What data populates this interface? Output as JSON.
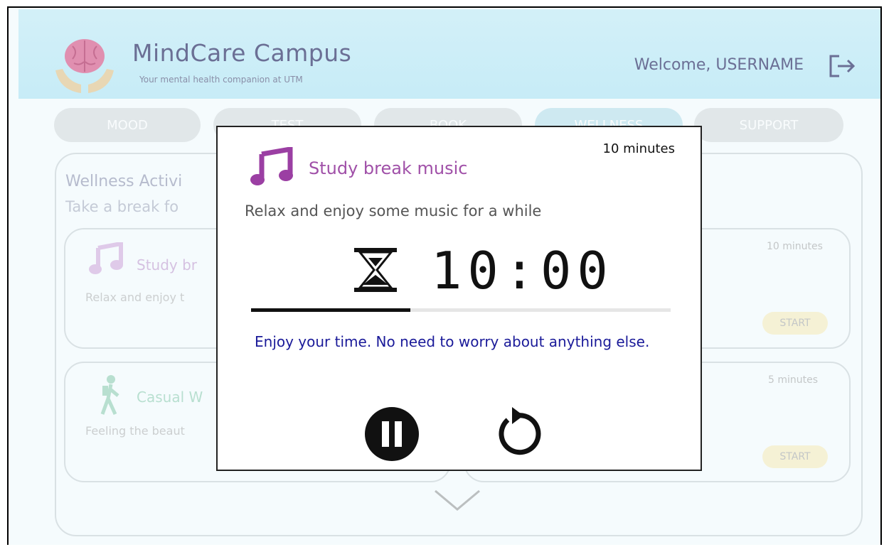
{
  "header": {
    "title": "MindCare Campus",
    "subtitle": "Your mental health companion at UTM",
    "welcome": "Welcome, USERNAME"
  },
  "nav": {
    "items": [
      "MOOD",
      "TEST",
      "BOOK",
      "WELLNESS",
      "SUPPORT"
    ]
  },
  "wellness": {
    "title": "Wellness Activi",
    "subtitle": "Take a break fo",
    "cards": [
      {
        "title": "Study br",
        "desc": "Relax and enjoy t",
        "duration": "10 minutes",
        "start": "START"
      },
      {
        "title": "Casual W",
        "desc": "Feeling the beaut",
        "duration": "5 minutes",
        "start": "START"
      }
    ]
  },
  "modal": {
    "duration": "10 minutes",
    "title": "Study break music",
    "description": "Relax and enjoy some music for a while",
    "timer": "10:00",
    "progress": 0.38,
    "message": "Enjoy your time. No need to worry about anything else.",
    "icons": {
      "note": "music-note-icon",
      "hourglass": "hourglass-icon",
      "pause": "pause-icon",
      "replay": "replay-icon"
    }
  },
  "colors": {
    "header_bg": "#c7ecf7",
    "modal_title": "#a050a8",
    "message": "#1a1a99",
    "start_bg": "#f7e7a6"
  }
}
